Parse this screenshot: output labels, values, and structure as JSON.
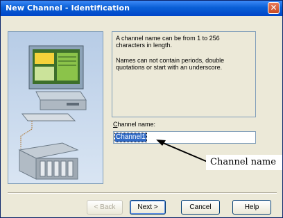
{
  "window": {
    "title": "New Channel - Identification",
    "close_glyph": "✕"
  },
  "info": {
    "line1": "A channel name can be from 1 to 256 characters in length.",
    "line2": "Names can not contain periods, double quotations or start with an underscore."
  },
  "field": {
    "label": "Channel name:",
    "value": "Channel1"
  },
  "callout": {
    "text": "Channel name"
  },
  "buttons": {
    "back": "< Back",
    "next": "Next >",
    "cancel": "Cancel",
    "help": "Help"
  },
  "colors": {
    "titlebar": "#0a5fd6",
    "selection": "#316ac5",
    "face": "#ece9d8"
  },
  "icons": {
    "art": "computer-network-illustration",
    "close": "close-icon",
    "arrow": "callout-arrow"
  }
}
